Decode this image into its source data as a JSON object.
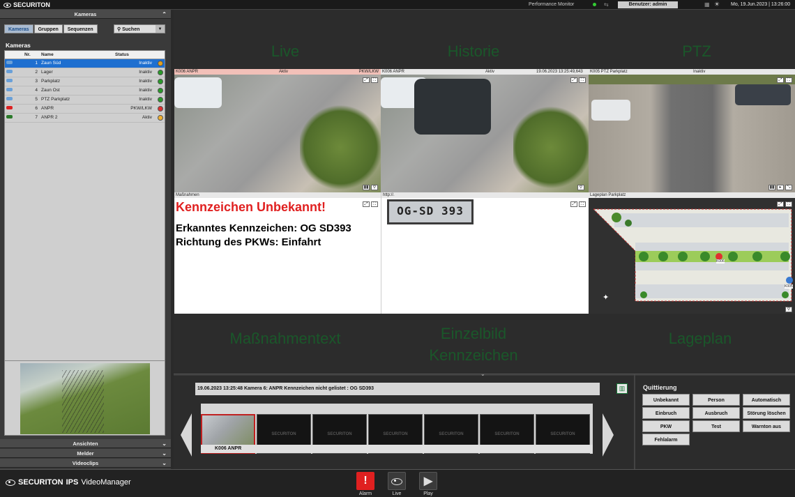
{
  "topbar": {
    "brand": "SECURITON",
    "performance_monitor": "Performance Monitor",
    "user_label": "Benutzer: admin",
    "datetime": "Mo, 19.Jun.2023 | 13:26:00"
  },
  "left": {
    "panel_title": "Kameras",
    "tabs": [
      "Kameras",
      "Gruppen",
      "Sequenzen"
    ],
    "search_label": "Suchen",
    "section_title": "Kameras",
    "columns": [
      "Nr.",
      "Name",
      "Status"
    ],
    "cameras": [
      {
        "nr": "1",
        "name": "Zaun Süd",
        "status": "Inaktiv",
        "icon": "camera-icon",
        "dot": "#e0a020"
      },
      {
        "nr": "2",
        "name": "Lager",
        "status": "Inaktiv",
        "icon": "camera-icon",
        "dot": "#2a9a2a"
      },
      {
        "nr": "3",
        "name": "Parkplatz",
        "status": "Inaktiv",
        "icon": "camera-icon",
        "dot": "#2a9a2a"
      },
      {
        "nr": "4",
        "name": "Zaun Ost",
        "status": "Inaktiv",
        "icon": "camera-icon",
        "dot": "#2a9a2a"
      },
      {
        "nr": "5",
        "name": "PTZ Parkplatz",
        "status": "Inaktiv",
        "icon": "ptz-camera-icon",
        "dot": "#2a9a2a"
      },
      {
        "nr": "6",
        "name": "ANPR",
        "status": "PKW/LKW",
        "icon": "anpr-camera-icon",
        "dot": "#e03030"
      },
      {
        "nr": "7",
        "name": "ANPR 2",
        "status": "Aktiv",
        "icon": "anpr-camera-icon",
        "dot": "#f0b030"
      }
    ],
    "bottom_panels": [
      "Ansichten",
      "Melder",
      "Videoclips"
    ]
  },
  "zone_labels": {
    "live": "Live",
    "historie": "Historie",
    "ptz": "PTZ",
    "massnahmentext": "Maßnahmentext",
    "einzelbild_1": "Einzelbild",
    "einzelbild_2": "Kennzeichen",
    "lageplan": "Lageplan"
  },
  "video": {
    "v1_cam": "K006   ANPR",
    "v1_status": "Aktiv",
    "v1_tag": "PKW/LKW",
    "v2_cam": "K006   ANPR",
    "v2_status": "Aktiv",
    "v2_time": "19.06.2023  13:25:49,643",
    "v3_cam": "K005   PTZ Parkplatz",
    "v3_status": "Inaktiv",
    "measures_hdr": "Maßnahmen",
    "url_hdr": "http://.",
    "map_hdr": "Lageplan Parkplatz",
    "plate_image_text": "OG-SD 393",
    "map_marker": "K006",
    "map_marker2": "K005"
  },
  "measures": {
    "headline": "Kennzeichen Unbekannt!",
    "line1": "Erkanntes Kennzeichen: OG SD393",
    "line2": "Richtung des PKWs: Einfahrt"
  },
  "event": {
    "text": "19.06.2023    13:25:48    Kamera    6:   ANPR    Kennzeichen nicht gelistet : OG SD393",
    "thumb_caption": "K006   ANPR",
    "placeholder": "SECURITON"
  },
  "quittierung": {
    "title": "Quittierung",
    "buttons": [
      "Unbekannt",
      "Person",
      "Automatisch",
      "Einbruch",
      "Ausbruch",
      "Störung löschen",
      "PKW",
      "Test",
      "Warnton aus",
      "Fehlalarm"
    ]
  },
  "bottom": {
    "brand": "SECURITON",
    "product_bold": "IPS",
    "product": "VideoManager",
    "buttons": [
      "Alarm",
      "Live",
      "Play"
    ]
  },
  "colors": {
    "alarm_red": "#e02020",
    "headline_red": "#e02020",
    "selection_blue": "#1e6fd0",
    "zone_green": "#1a5a2a"
  }
}
